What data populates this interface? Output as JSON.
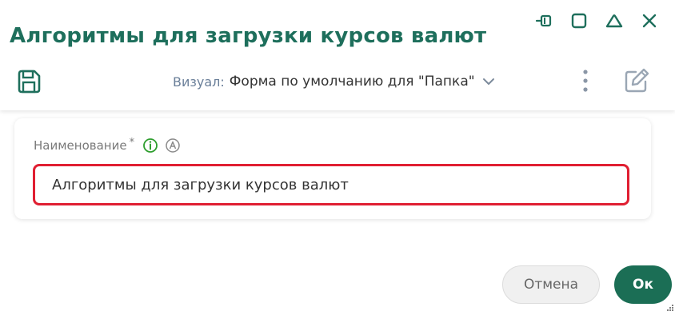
{
  "window": {
    "title": "Алгоритмы для загрузки курсов валют",
    "controls": [
      {
        "icon": "pin-icon"
      },
      {
        "icon": "maximize-icon"
      },
      {
        "icon": "collapse-icon"
      },
      {
        "icon": "close-icon"
      }
    ]
  },
  "toolbar": {
    "save_icon": "save-icon",
    "visual_label": "Визуал:",
    "visual_value": "Форма по умолчанию для \"Папка\"",
    "more_icon": "more-vertical-icon",
    "edit_icon": "edit-icon"
  },
  "form": {
    "name_label": "Наименование",
    "required_mark": "*",
    "name_value": "Алгоритмы для загрузки курсов валют"
  },
  "footer": {
    "cancel_label": "Отмена",
    "ok_label": "Ок"
  },
  "colors": {
    "accent": "#1b6e55",
    "title": "#1e6f5c",
    "error_border": "#e01f32",
    "info_icon": "#2e9e2e"
  }
}
